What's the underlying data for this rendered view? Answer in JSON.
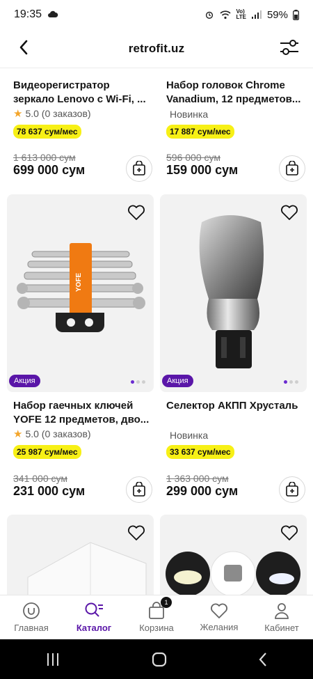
{
  "status": {
    "time": "19:35",
    "battery": "59%"
  },
  "header": {
    "title": "retrofit.uz"
  },
  "products": [
    {
      "title": "Видеорегистратор зеркало Lenovo с Wi-Fi, ...",
      "rating": "5.0 (0 заказов)",
      "monthly": "78 637 сум/мес",
      "old_price": "1 613 000 сум",
      "price": "699 000 сум"
    },
    {
      "title": "Набор головок Chrome Vanadium, 12 предметов...",
      "badge": "Новинка",
      "monthly": "17 887 сум/мес",
      "old_price": "596 000 сум",
      "price": "159 000 сум"
    },
    {
      "title": "Набор гаечных ключей YOFE 12 предметов, дво...",
      "rating": "5.0 (0 заказов)",
      "monthly": "25 987 сум/мес",
      "old_price": "341 000 сум",
      "price": "231 000 сум",
      "promo": "Акция",
      "brand_on_image": "YOFE"
    },
    {
      "title": "Селектор АКПП Хрусталь",
      "badge": "Новинка",
      "monthly": "33 637 сум/мес",
      "old_price": "1 363 000 сум",
      "price": "299 000 сум",
      "promo": "Акция"
    }
  ],
  "nav": [
    {
      "label": "Главная",
      "icon": "home-icon"
    },
    {
      "label": "Каталог",
      "icon": "catalog-search-icon",
      "active": true
    },
    {
      "label": "Корзина",
      "icon": "cart-icon",
      "badge": "1"
    },
    {
      "label": "Желания",
      "icon": "heart-icon"
    },
    {
      "label": "Кабинет",
      "icon": "user-icon"
    }
  ],
  "colors": {
    "accent": "#5a16a8",
    "installment": "#f7f016",
    "star": "#f3a52b"
  }
}
